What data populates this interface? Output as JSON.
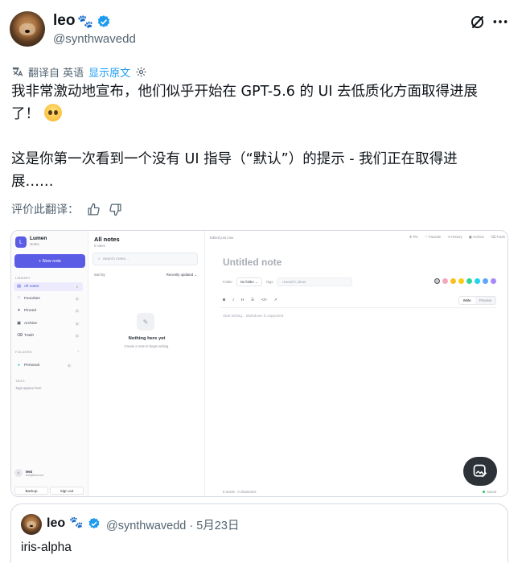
{
  "tweet": {
    "author": {
      "name": "leo",
      "handle": "@synthwavedd"
    },
    "translate": {
      "from_label": "翻译自 英语",
      "show_original": "显示原文"
    },
    "paragraph1_line1": "我非常激动地宣布，他们似乎开始在 GPT-5.6 的 UI 去低质化方面取得进展",
    "paragraph1_line2": "了！",
    "paragraph2_line1": "这是你第一次看到一个没有 UI 指导（“默认”）的提示 - 我们正在取得进",
    "paragraph2_line2": "展……",
    "rate_translation": "评价此翻译："
  },
  "app": {
    "brand": "Lumen",
    "brand_sub": "Notes",
    "new_note": "+ New note",
    "library_label": "LIBRARY",
    "nav": [
      {
        "label": "All notes",
        "count": "0"
      },
      {
        "label": "Favorites",
        "count": "0"
      },
      {
        "label": "Pinned",
        "count": "0"
      },
      {
        "label": "Archive",
        "count": "0"
      },
      {
        "label": "Trash",
        "count": "0"
      }
    ],
    "folders_label": "FOLDERS",
    "folders_add": "+",
    "folder": {
      "label": "Personal",
      "count": "0"
    },
    "tags_label": "TAGS",
    "tags_empty": "Tags appear here",
    "user": {
      "initial": "T",
      "name": "test",
      "email": "test@test.com"
    },
    "backup": "Backup",
    "signout": "Sign out",
    "list": {
      "title": "All notes",
      "count": "0 notes",
      "search_placeholder": "Search notes...",
      "sort_by": "Sort by",
      "sort_value": "Recently updated",
      "empty_title": "Nothing here yet",
      "empty_sub": "Create a note to begin writing."
    },
    "editor": {
      "edited": "Edited just now",
      "actions": [
        "Pin",
        "Favorite",
        "History",
        "Archive",
        "Trash"
      ],
      "title_placeholder": "Untitled note",
      "folder_label": "Folder",
      "folder_value": "No folder",
      "tags_label": "Tags",
      "tags_placeholder": "research, ideas",
      "swatches": [
        "#c9ccd2",
        "#f7a8b8",
        "#fbbf24",
        "#facc15",
        "#34d399",
        "#22d3ee",
        "#60a5fa",
        "#a78bfa"
      ],
      "tools": [
        "B",
        "I",
        "H",
        "☰",
        "</>",
        "↗"
      ],
      "tab_write": "Write",
      "tab_preview": "Preview",
      "body_placeholder": "Start writing... Markdown is supported.",
      "footer": "0 words · 0 characters",
      "saved": "Saved"
    }
  },
  "quote": {
    "name": "leo",
    "handle": "@synthwavedd",
    "date": "· 5月23日",
    "text": "iris-alpha"
  }
}
